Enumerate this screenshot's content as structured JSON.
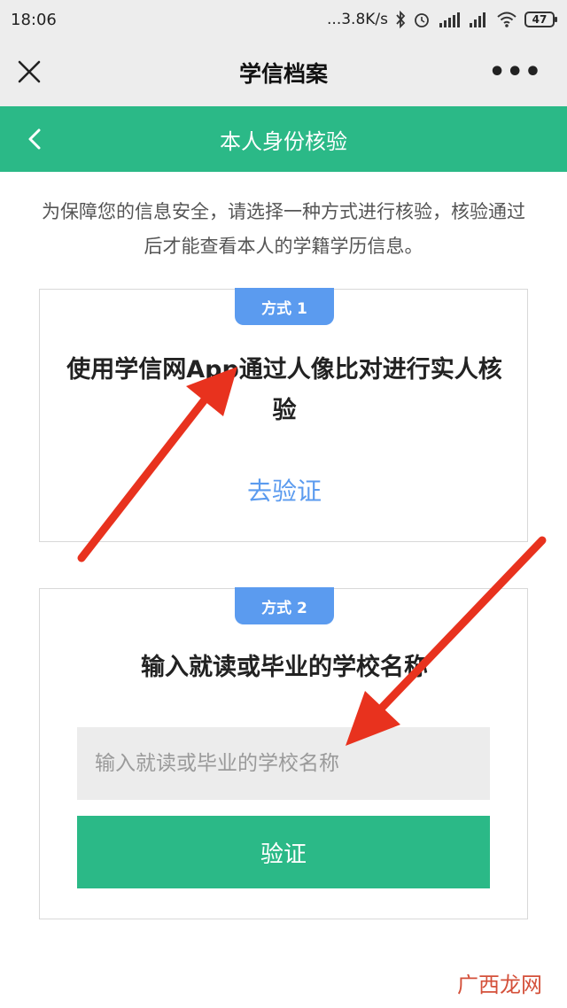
{
  "status_bar": {
    "time": "18:06",
    "network_speed": "...3.8K/s",
    "battery": "47",
    "icons": [
      "bluetooth-icon",
      "alarm-icon",
      "hd-signal-icon",
      "signal-icon",
      "wifi-icon",
      "battery-icon"
    ]
  },
  "title_bar": {
    "title": "学信档案",
    "close_icon": "close-icon",
    "more_icon": "more-icon",
    "more_label": "•••"
  },
  "header": {
    "title": "本人身份核验",
    "back_icon": "chevron-left-icon"
  },
  "intro": "为保障您的信息安全，请选择一种方式进行核验，核验通过后才能查看本人的学籍学历信息。",
  "method1": {
    "badge": "方式 1",
    "title": "使用学信网App通过人像比对进行实人核验",
    "link": "去验证"
  },
  "method2": {
    "badge": "方式 2",
    "title": "输入就读或毕业的学校名称",
    "input_placeholder": "输入就读或毕业的学校名称",
    "input_value": "",
    "button": "验证"
  },
  "watermark": "广西龙网",
  "colors": {
    "green": "#2bb987",
    "blue": "#5b9bef",
    "arrow": "#e8321e",
    "gray_bar": "#ededed"
  }
}
